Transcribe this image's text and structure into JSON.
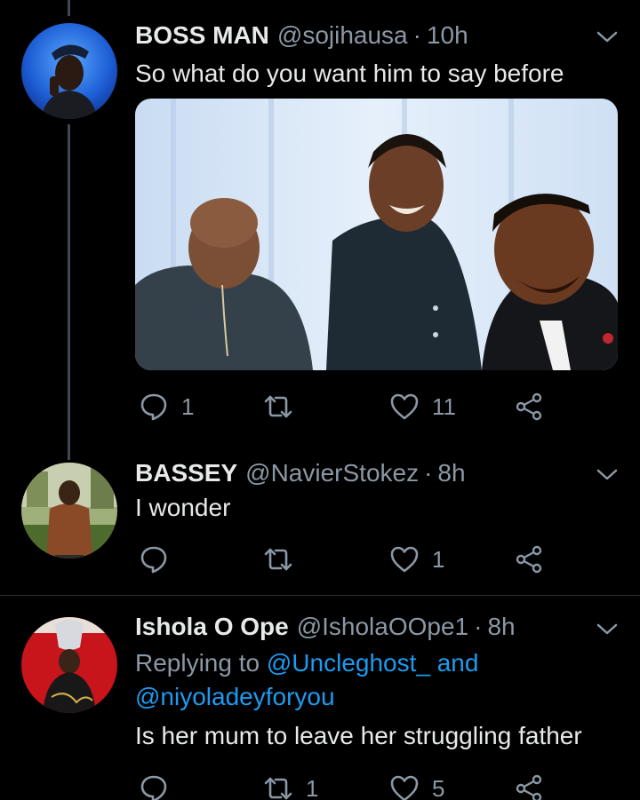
{
  "tweets": [
    {
      "name": "BOSS MAN",
      "handle": "@sojihausa",
      "dot": "·",
      "time": "10h",
      "text": "So what do you want him to say before",
      "replies": "1",
      "retweets": "",
      "likes": "11",
      "has_media": true
    },
    {
      "name": "BASSEY",
      "handle": "@NavierStokez",
      "dot": "·",
      "time": "8h",
      "text": "I wonder",
      "replies": "",
      "retweets": "",
      "likes": "1"
    },
    {
      "name": "Ishola O Ope",
      "handle": "@IsholaOOpe1",
      "dot": "·",
      "time": "8h",
      "replying_prefix": "Replying to",
      "reply_mention_1": "@Uncleghost_",
      "reply_and": "and",
      "reply_mention_2": "@niyoladeyforyou",
      "text": "Is her mum to leave her struggling father",
      "replies": "",
      "retweets": "1",
      "likes": "5"
    }
  ],
  "icons": {
    "reply": "reply-icon",
    "retweet": "retweet-icon",
    "like": "like-icon",
    "share": "share-icon",
    "more": "chevron-down-icon"
  },
  "colors": {
    "background": "#000000",
    "text": "#e7e9ea",
    "secondary": "#8b98a5",
    "link": "#1d9bf0",
    "thread_line": "#3d4a55"
  }
}
